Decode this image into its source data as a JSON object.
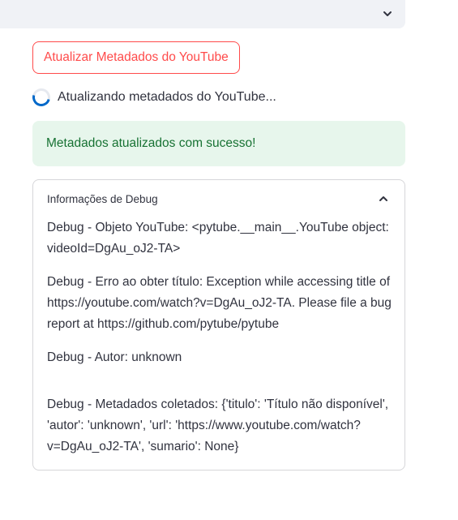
{
  "top_expander": {
    "icon": "chevron-down-icon"
  },
  "update_button": {
    "label": "Atualizar Metadados do YouTube",
    "color": "#ff4b4b"
  },
  "spinner": {
    "text": "Atualizando metadados do YouTube...",
    "color": "#0068c9"
  },
  "success": {
    "text": "Metadados atualizados com sucesso!",
    "color": "#177233",
    "background": "#e7f6ec"
  },
  "debug_expander": {
    "title": "Informações de Debug",
    "icon": "chevron-up-icon",
    "lines": [
      "Debug - Objeto YouTube: <pytube.__main__.YouTube object:",
      "videoId=DgAu_oJ2-TA>",
      "Debug - Erro ao obter título: Exception while accessing title of",
      "https://youtube.com/watch?v=DgAu_oJ2-TA. Please file a bug",
      "report at https://github.com/pytube/pytube",
      "Debug - Autor: unknown",
      "Debug - Metadados coletados: {'titulo': 'Título não disponível',",
      "'autor': 'unknown', 'url': 'https://www.youtube.com/watch?",
      "v=DgAu_oJ2-TA', 'sumario': None}"
    ]
  }
}
